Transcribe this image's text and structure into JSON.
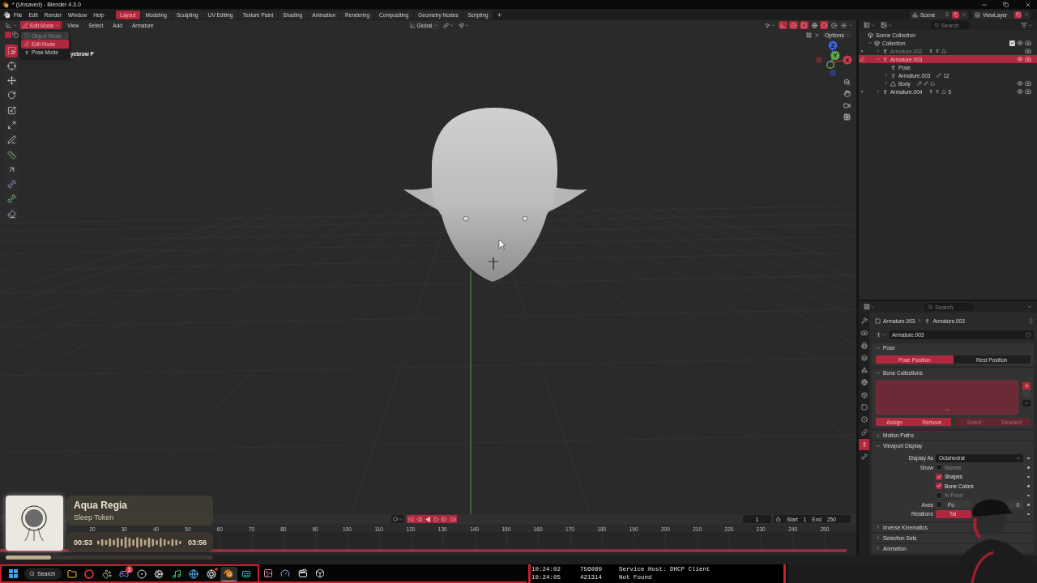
{
  "window": {
    "title": "* (Unsaved) - Blender 4.3.0"
  },
  "menu": [
    "File",
    "Edit",
    "Render",
    "Window",
    "Help"
  ],
  "workspaces": [
    {
      "label": "Layout",
      "selected": true
    },
    {
      "label": "Modeling",
      "selected": false
    },
    {
      "label": "Sculpting",
      "selected": false
    },
    {
      "label": "UV Editing",
      "selected": false
    },
    {
      "label": "Texture Paint",
      "selected": false
    },
    {
      "label": "Shading",
      "selected": false
    },
    {
      "label": "Animation",
      "selected": false
    },
    {
      "label": "Rendering",
      "selected": false
    },
    {
      "label": "Compositing",
      "selected": false
    },
    {
      "label": "Geometry Nodes",
      "selected": false
    },
    {
      "label": "Scripting",
      "selected": false
    }
  ],
  "scene": "Scene",
  "view_layer": "ViewLayer",
  "viewport": {
    "mode": "Edit Mode",
    "menus": [
      "View",
      "Select",
      "Add",
      "Armature"
    ],
    "orientation": "Global",
    "options": "Options",
    "toggles": [
      {
        "kind": "gizmos",
        "on": true
      },
      {
        "kind": "overlays",
        "on": true
      },
      {
        "kind": "xray",
        "on": true
      }
    ],
    "shading": [
      {
        "kind": "wireframe",
        "selected": false
      },
      {
        "kind": "solid",
        "selected": true
      },
      {
        "kind": "material",
        "selected": false
      },
      {
        "kind": "rendered",
        "selected": false
      }
    ],
    "mode_menu": [
      {
        "kind": "object",
        "label": "Object Mode",
        "selected": false,
        "disabled": true
      },
      {
        "kind": "edit",
        "label": "Edit Mode",
        "selected": true,
        "disabled": false
      },
      {
        "kind": "pose",
        "label": "Pose Mode",
        "selected": false,
        "disabled": false
      }
    ],
    "info_text": "yebrow P",
    "tools": [
      {
        "kind": "select",
        "selected": true
      },
      {
        "kind": "cursor",
        "selected": false
      },
      {
        "kind": "move",
        "selected": false
      },
      {
        "kind": "rotate",
        "selected": false
      },
      {
        "kind": "scale",
        "selected": false
      },
      {
        "kind": "transform",
        "selected": false
      },
      {
        "kind": "annotate",
        "selected": false
      },
      {
        "kind": "measure",
        "selected": false
      },
      {
        "kind": "extrude",
        "selected": false
      },
      {
        "kind": "bone-size",
        "selected": false
      },
      {
        "kind": "envelope",
        "selected": false
      },
      {
        "kind": "roll",
        "selected": false
      }
    ],
    "gizmo": [
      {
        "label": "Z",
        "color": "#3d62d4"
      },
      {
        "label": "Y",
        "color": "#5ea84c"
      },
      {
        "label": "X",
        "color": "#d03a4d"
      }
    ]
  },
  "timeline": {
    "frame": "1",
    "start_label": "Start",
    "start": "1",
    "end_label": "End",
    "end": "250",
    "ruler": [
      "20",
      "30",
      "40",
      "50",
      "60",
      "70",
      "80",
      "90",
      "100",
      "110",
      "120",
      "130",
      "140",
      "150",
      "160",
      "170",
      "180",
      "190",
      "200",
      "210",
      "220",
      "230",
      "240",
      "250"
    ]
  },
  "outliner": {
    "search_placeholder": "Search",
    "tree": [
      {
        "label": "Scene Collection",
        "kind": "scene",
        "selected": false,
        "hidden": false,
        "children": [
          {
            "label": "Collection",
            "kind": "collection",
            "expanded": true,
            "checked": true,
            "selected": false,
            "hidden": false,
            "children": [
              {
                "label": "Armature.002",
                "kind": "armature",
                "expanded": false,
                "selected": false,
                "hidden": true
              },
              {
                "label": "Armature.003",
                "kind": "armature",
                "expanded": true,
                "selected": true,
                "hidden": false,
                "children": [
                  {
                    "label": "Pose",
                    "kind": "pose",
                    "selected": false,
                    "hidden": false
                  },
                  {
                    "label": "Armature.003",
                    "kind": "data",
                    "expanded": false,
                    "selected": false,
                    "hidden": false,
                    "count": "12"
                  },
                  {
                    "label": "Body",
                    "kind": "mesh",
                    "expanded": false,
                    "selected": false,
                    "hidden": false
                  }
                ]
              },
              {
                "label": "Armature.004",
                "kind": "armature",
                "expanded": false,
                "selected": false,
                "hidden": false,
                "count": "5"
              }
            ]
          }
        ]
      }
    ]
  },
  "properties": {
    "search_placeholder": "Search",
    "tabs": [
      {
        "kind": "tool",
        "selected": false
      },
      {
        "kind": "render",
        "selected": false
      },
      {
        "kind": "output",
        "selected": false
      },
      {
        "kind": "view-layer",
        "selected": false
      },
      {
        "kind": "scene",
        "selected": false
      },
      {
        "kind": "world",
        "selected": false
      },
      {
        "kind": "collection",
        "selected": false
      },
      {
        "kind": "object",
        "selected": false
      },
      {
        "kind": "physics",
        "selected": false
      },
      {
        "kind": "constraints",
        "selected": false
      },
      {
        "kind": "armature",
        "selected": true
      },
      {
        "kind": "bone",
        "selected": false
      }
    ],
    "breadcrumb": [
      "Armature.003",
      "Armature.003"
    ],
    "datablock": "Armature.003",
    "panels": [
      {
        "title": "Pose",
        "kind": "pose",
        "expanded": true,
        "options": [
          {
            "label": "Pose Position",
            "selected": true
          },
          {
            "label": "Rest Position",
            "selected": false
          }
        ]
      },
      {
        "title": "Bone Collections",
        "kind": "bone-collections",
        "expanded": true,
        "buttons": [
          {
            "label": "Assign",
            "disabled": false
          },
          {
            "label": "Remove",
            "disabled": false
          },
          {
            "label": "Select",
            "disabled": true
          },
          {
            "label": "Deselect",
            "disabled": true
          }
        ]
      },
      {
        "title": "Motion Paths",
        "expanded": false
      },
      {
        "title": "Viewport Display",
        "kind": "display",
        "expanded": true,
        "rows": [
          {
            "kind": "dropdown",
            "label": "Display As",
            "value": "Octahedral"
          },
          {
            "kind": "checkbox",
            "label": "Show",
            "text": "Names",
            "checked": false
          },
          {
            "kind": "checkbox",
            "text": "Shapes",
            "checked": true
          },
          {
            "kind": "checkbox",
            "text": "Bone Colors",
            "checked": true
          },
          {
            "kind": "checkbox",
            "text": "In Front",
            "checked": false
          },
          {
            "kind": "axes",
            "label": "Axes",
            "checked": false,
            "value": "Po",
            "number": "0"
          },
          {
            "kind": "enum",
            "label": "Relations",
            "value": "Tai"
          }
        ]
      },
      {
        "title": "Inverse Kinematics",
        "expanded": false
      },
      {
        "title": "Selection Sets",
        "expanded": false
      },
      {
        "title": "Animation",
        "expanded": false
      }
    ]
  },
  "media_player": {
    "title": "Aqua Regia",
    "artist": "Sleep Token",
    "elapsed": "00:53",
    "duration": "03:56",
    "level": 0.22
  },
  "taskbar": {
    "search": "Search",
    "apps": [
      {
        "kind": "folder",
        "active": false,
        "dot": false
      },
      {
        "kind": "ring",
        "active": false,
        "dot": false
      },
      {
        "kind": "paw",
        "active": false,
        "dot": false
      },
      {
        "kind": "chat",
        "active": false,
        "dot": false,
        "badge": "3"
      },
      {
        "kind": "steam",
        "active": false,
        "dot": false
      },
      {
        "kind": "gear",
        "active": false,
        "dot": false
      },
      {
        "kind": "music",
        "active": false,
        "dot": false
      },
      {
        "kind": "browser",
        "active": false,
        "dot": false
      },
      {
        "kind": "aperture",
        "active": false,
        "dot": true
      },
      {
        "kind": "blender",
        "active": true,
        "dot": false
      },
      {
        "kind": "captions",
        "active": false,
        "dot": false
      }
    ],
    "tray_apps": [
      {
        "kind": "image",
        "active": false,
        "dot": false
      },
      {
        "kind": "gauge",
        "active": false,
        "dot": false
      },
      {
        "kind": "clapperboard",
        "active": false,
        "dot": false
      },
      {
        "kind": "cube",
        "active": false,
        "dot": false
      }
    ]
  },
  "terminal": [
    {
      "time": "10:24:02",
      "pid": "756080",
      "message": "Service Host: DHCP Client"
    },
    {
      "time": "10:24:05",
      "pid": "421314",
      "message": "Not Found"
    }
  ]
}
